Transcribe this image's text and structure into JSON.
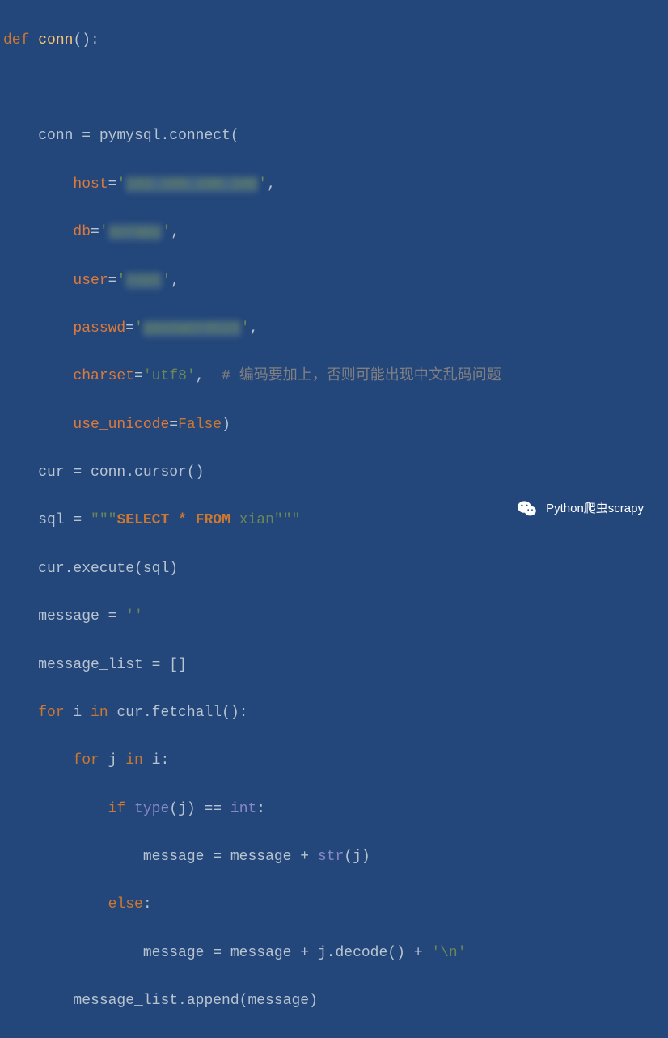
{
  "code": {
    "l1_def": "def ",
    "l1_fn": "conn",
    "l1_paren": "():",
    "l3_var": "conn",
    "l3_eq": " = ",
    "l3_pymysql": "pymysql",
    "l3_connect": ".connect(",
    "l4_host": "host",
    "l4_eq": "=",
    "l4_q1": "'",
    "l4_val": "192.168.100.100",
    "l4_q2": "'",
    "l4_comma": ",",
    "l5_db": "db",
    "l5_eq": "=",
    "l5_q1": "'",
    "l5_val": "scrapy",
    "l5_q2": "'",
    "l5_comma": ",",
    "l6_user": "user",
    "l6_eq": "=",
    "l6_q1": "'",
    "l6_val": "root",
    "l6_q2": "'",
    "l6_comma": ",",
    "l7_passwd": "passwd",
    "l7_eq": "=",
    "l7_q1": "'",
    "l7_val": "password123",
    "l7_q2": "'",
    "l7_comma": ",",
    "l8_charset": "charset",
    "l8_eq": "=",
    "l8_val": "'utf8'",
    "l8_comma": ",",
    "l8_comment": "  # 编码要加上，否则可能出现中文乱码问题",
    "l9_uu": "use_unicode",
    "l9_eq": "=",
    "l9_false": "False",
    "l9_close": ")",
    "l10_cur": "cur",
    "l10_rest": " = conn.cursor()",
    "l11_sql": "sql",
    "l11_eq": " = ",
    "l11_q1": "\"\"\"",
    "l11_select": "SELECT",
    "l11_sp1": " ",
    "l11_star": "*",
    "l11_sp2": " ",
    "l11_from": "FROM",
    "l11_xian": " xian",
    "l11_q2": "\"\"\"",
    "l12": "cur.execute(sql)",
    "l13_msg": "message",
    "l13_eq": " = ",
    "l13_val": "''",
    "l14": "message_list = []",
    "l15_for": "for",
    "l15_i": " i ",
    "l15_in": "in",
    "l15_rest": " cur.fetchall():",
    "l16_for": "for",
    "l16_j": " j ",
    "l16_in": "in",
    "l16_i": " i:",
    "l17_if": "if",
    "l17_sp": " ",
    "l17_type": "type",
    "l17_j": "(j) == ",
    "l17_int": "int",
    "l17_colon": ":",
    "l18_msg": "message",
    "l18_rest": " = message + ",
    "l18_str": "str",
    "l18_j": "(j)",
    "l19_else": "else",
    "l19_colon": ":",
    "l20_msg": "message",
    "l20_rest": " = message + j.decode() + ",
    "l20_nl": "'\\n'",
    "l21": "message_list.append(message)"
  },
  "watermark": {
    "text": "Python爬虫scrapy"
  }
}
